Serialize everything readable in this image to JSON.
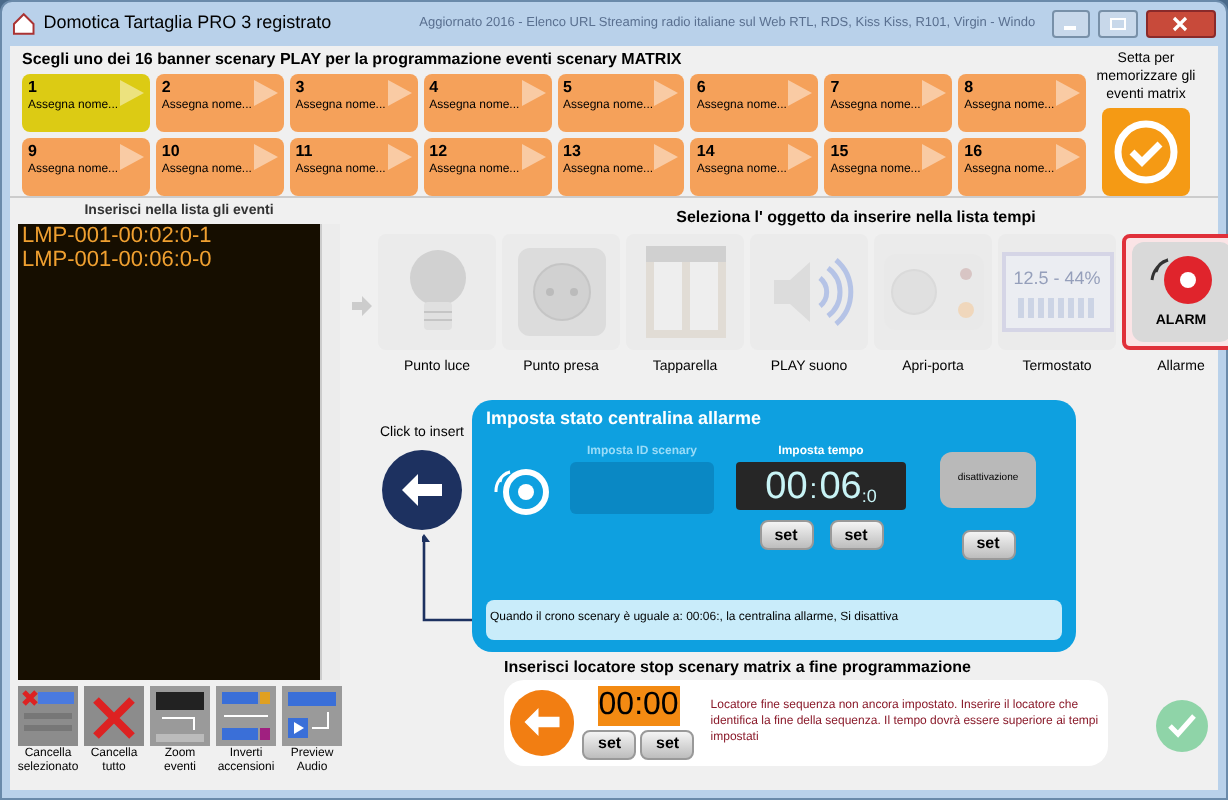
{
  "window": {
    "title": "Domotica Tartaglia PRO 3 registrato",
    "background_text": "Aggiornato 2016 - Elenco URL Streaming radio italiane sul Web RTL, RDS, Kiss Kiss, R101, Virgin - Windo"
  },
  "banners": {
    "heading": "Scegli uno dei 16 banner scenary PLAY per la programmazione eventi scenary MATRIX",
    "items": [
      {
        "number": "1",
        "label": "Assegna nome...",
        "selected": true
      },
      {
        "number": "2",
        "label": "Assegna nome...",
        "selected": false
      },
      {
        "number": "3",
        "label": "Assegna nome...",
        "selected": false
      },
      {
        "number": "4",
        "label": "Assegna nome...",
        "selected": false
      },
      {
        "number": "5",
        "label": "Assegna nome...",
        "selected": false
      },
      {
        "number": "6",
        "label": "Assegna nome...",
        "selected": false
      },
      {
        "number": "7",
        "label": "Assegna nome...",
        "selected": false
      },
      {
        "number": "8",
        "label": "Assegna nome...",
        "selected": false
      },
      {
        "number": "9",
        "label": "Assegna nome...",
        "selected": false
      },
      {
        "number": "10",
        "label": "Assegna nome...",
        "selected": false
      },
      {
        "number": "11",
        "label": "Assegna nome...",
        "selected": false
      },
      {
        "number": "12",
        "label": "Assegna nome...",
        "selected": false
      },
      {
        "number": "13",
        "label": "Assegna nome...",
        "selected": false
      },
      {
        "number": "14",
        "label": "Assegna nome...",
        "selected": false
      },
      {
        "number": "15",
        "label": "Assegna nome...",
        "selected": false
      },
      {
        "number": "16",
        "label": "Assegna nome...",
        "selected": false
      }
    ],
    "save_label": "Setta per memorizzare gli eventi matrix"
  },
  "events": {
    "title": "Inserisci nella lista gli eventi",
    "items": [
      "LMP-001-00:02:0-1",
      "LMP-001-00:06:0-0"
    ]
  },
  "tools": [
    {
      "kind": "delete_selected",
      "label": "Cancella selezionato"
    },
    {
      "kind": "delete_all",
      "label": "Cancella tutto"
    },
    {
      "kind": "zoom",
      "label": "Zoom eventi"
    },
    {
      "kind": "invert",
      "label": "Inverti accensioni"
    },
    {
      "kind": "preview",
      "label": "Preview Audio"
    }
  ],
  "objects": {
    "title": "Seleziona l' oggetto da inserire nella lista tempi",
    "items": [
      {
        "kind": "light",
        "label": "Punto luce",
        "selected": false
      },
      {
        "kind": "socket",
        "label": "Punto presa",
        "selected": false
      },
      {
        "kind": "shutter",
        "label": "Tapparella",
        "selected": false
      },
      {
        "kind": "sound",
        "label": "PLAY suono",
        "selected": false
      },
      {
        "kind": "door",
        "label": "Apri-porta",
        "selected": false
      },
      {
        "kind": "thermostat",
        "label": "Termostato",
        "selected": false,
        "display": "12.5 - 44%"
      },
      {
        "kind": "alarm",
        "label": "Allarme",
        "selected": true,
        "display": "ALARM"
      }
    ]
  },
  "insert": {
    "label": "Click to insert"
  },
  "alarm_panel": {
    "title": "Imposta stato centralina allarme",
    "scenary_id": {
      "label": "Imposta ID scenary",
      "disabled": true
    },
    "time_label": "Imposta tempo",
    "time": {
      "hours": "00",
      "separator": ":",
      "minutes": "06",
      "tenths": ":0"
    },
    "state_button": "disattivazione",
    "set_buttons": [
      "set",
      "set",
      "set"
    ],
    "summary": "Quando il crono scenary  è uguale a: 00:06:, la centralina allarme, Si disattiva"
  },
  "locator": {
    "title": "Inserisci locatore stop scenary matrix a fine programmazione",
    "time": "00:00",
    "set_buttons": [
      "set",
      "set"
    ],
    "message": "Locatore fine sequenza non ancora impostato. Inserire il locatore che identifica la fine della sequenza. Il tempo dovrà essere superiore ai tempi impostati"
  }
}
